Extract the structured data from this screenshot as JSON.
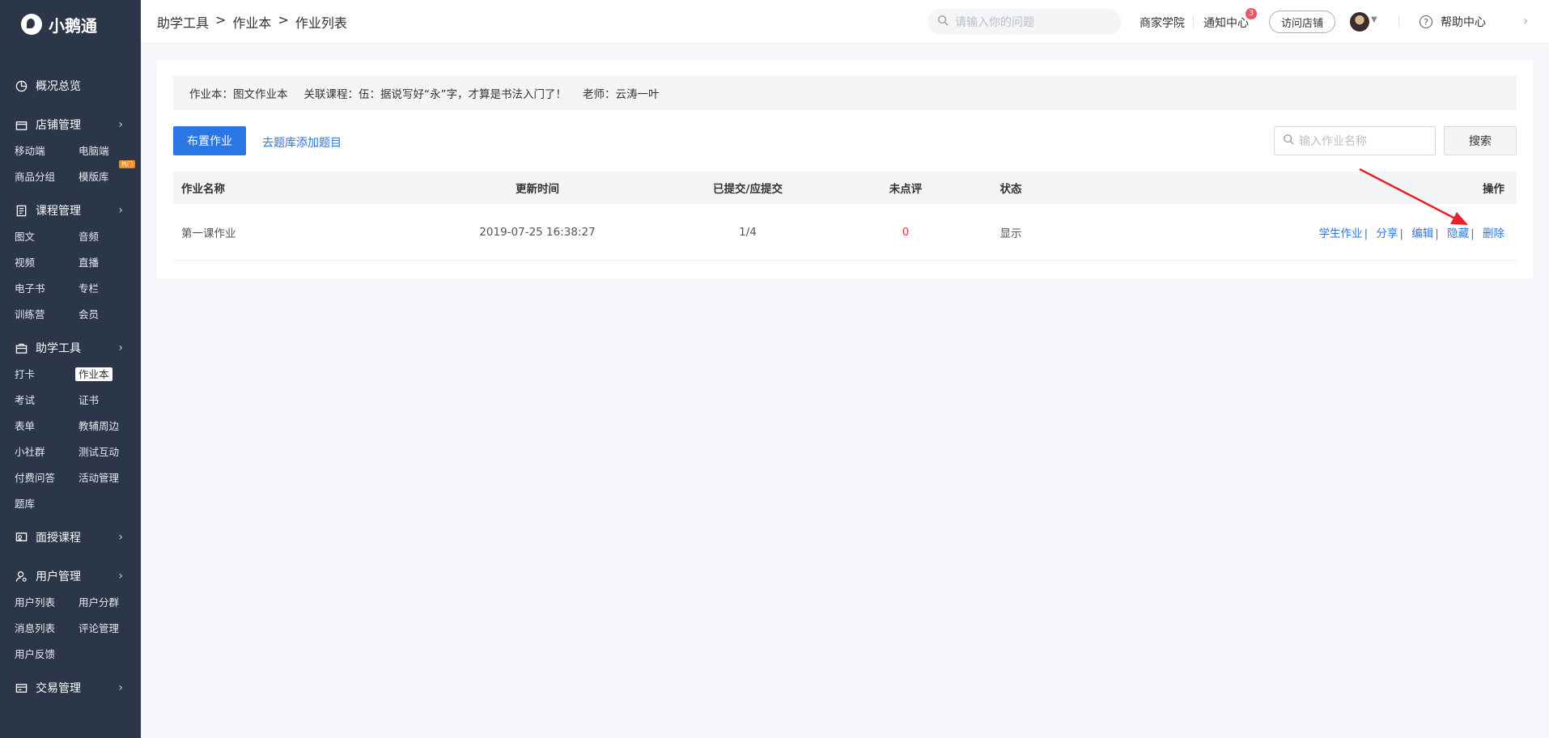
{
  "app": {
    "name": "小鹅通"
  },
  "sidebar": {
    "sections": [
      {
        "label": "概况总览",
        "icon": "pie-chart-icon",
        "items": []
      },
      {
        "label": "店铺管理",
        "icon": "store-icon",
        "items": [
          "移动端",
          "电脑端",
          "商品分组",
          "模版库"
        ],
        "badge": "热门"
      },
      {
        "label": "课程管理",
        "icon": "book-icon",
        "items": [
          "图文",
          "音频",
          "视频",
          "直播",
          "电子书",
          "专栏",
          "训练营",
          "会员"
        ]
      },
      {
        "label": "助学工具",
        "icon": "toolbox-icon",
        "items": [
          "打卡",
          "作业本",
          "考试",
          "证书",
          "表单",
          "教辅周边",
          "小社群",
          "测试互动",
          "付费问答",
          "活动管理",
          "题库"
        ],
        "active": "作业本"
      },
      {
        "label": "面授课程",
        "icon": "classroom-icon",
        "items": []
      },
      {
        "label": "用户管理",
        "icon": "user-icon",
        "items": [
          "用户列表",
          "用户分群",
          "消息列表",
          "评论管理",
          "用户反馈"
        ]
      },
      {
        "label": "交易管理",
        "icon": "card-icon",
        "items": []
      }
    ]
  },
  "header": {
    "breadcrumb": [
      "助学工具",
      "作业本",
      "作业列表"
    ],
    "search_placeholder": "请输入你的问题",
    "links": {
      "academy": "商家学院",
      "notify": "通知中心",
      "notify_count": "3",
      "visit": "访问店铺",
      "help": "帮助中心"
    }
  },
  "info": {
    "book": "作业本：图文作业本",
    "course": "关联课程：伍：据说写好“永”字，才算是书法入门了！",
    "teacher": "老师：云涛一叶"
  },
  "toolbar": {
    "assign_label": "布置作业",
    "add_link": "去题库添加题目",
    "search_placeholder": "输入作业名称",
    "search_btn": "搜索"
  },
  "table": {
    "headers": [
      "作业名称",
      "更新时间",
      "已提交/应提交",
      "未点评",
      "状态",
      "操作"
    ],
    "rows": [
      {
        "name": "第一课作业",
        "time": "2019-07-25 16:38:27",
        "submitted": "1/4",
        "unreviewed": "0",
        "status": "显示",
        "ops": [
          "学生作业",
          "分享",
          "编辑",
          "隐藏",
          "删除"
        ]
      }
    ]
  },
  "colors": {
    "sidebar": "#2b3648",
    "accent": "#2a76e5",
    "annotation_arrow": "#e8212b",
    "unreviewed": "#f52e2e"
  }
}
